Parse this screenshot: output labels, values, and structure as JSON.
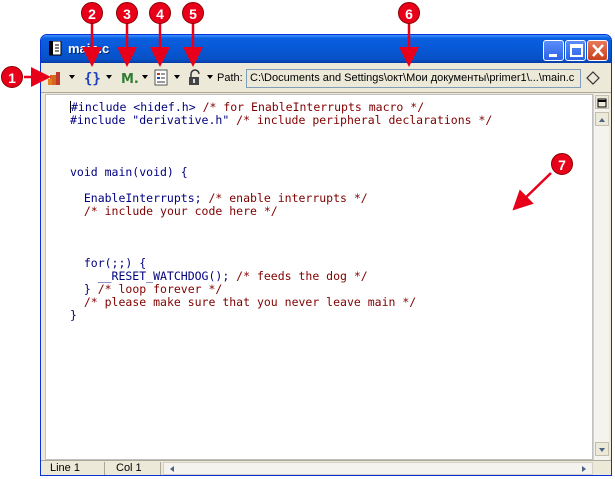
{
  "window": {
    "title": "main.c"
  },
  "toolbar": {
    "path_label": "Path:",
    "path_value": "C:\\Documents and Settings\\окт\\Мои документы\\primer1\\...\\main.c"
  },
  "editor": {
    "lines": [
      [
        "#include <hidef.h> ",
        "/* for EnableInterrupts macro */"
      ],
      [
        "#include \"derivative.h\" ",
        "/* include peripheral declarations */"
      ],
      [
        "",
        ""
      ],
      [
        "",
        ""
      ],
      [
        "",
        ""
      ],
      [
        "void main(void) {",
        ""
      ],
      [
        "",
        ""
      ],
      [
        "  EnableInterrupts; ",
        "/* enable interrupts */"
      ],
      [
        "  ",
        "/* include your code here */"
      ],
      [
        "",
        ""
      ],
      [
        "",
        ""
      ],
      [
        "",
        ""
      ],
      [
        "  for(;;) {",
        ""
      ],
      [
        "    __RESET_WATCHDOG(); ",
        "/* feeds the dog */"
      ],
      [
        "  } ",
        "/* loop forever */"
      ],
      [
        "  ",
        "/* please make sure that you never leave main */"
      ],
      [
        "}",
        ""
      ]
    ]
  },
  "statusbar": {
    "line": "Line 1",
    "col": "Col 1"
  },
  "callouts": [
    "1",
    "2",
    "3",
    "4",
    "5",
    "6",
    "7"
  ],
  "colors": {
    "callout": "#e8001a",
    "titlebar": "#0858d6",
    "keyword": "#000080",
    "comment": "#800000"
  }
}
